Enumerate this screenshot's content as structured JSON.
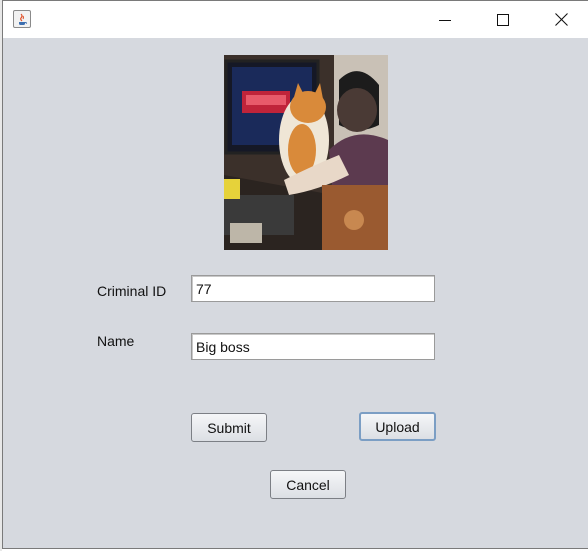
{
  "window": {
    "title": "",
    "app_icon": "java-icon",
    "controls": {
      "minimize": "minimize-icon",
      "maximize": "maximize-icon",
      "close": "close-icon"
    }
  },
  "photo": {
    "description_icon": "photo"
  },
  "form": {
    "criminal_id_label": "Criminal ID",
    "criminal_id_value": "77",
    "name_label": "Name",
    "name_value": "Big boss"
  },
  "buttons": {
    "submit": "Submit",
    "upload": "Upload",
    "cancel": "Cancel"
  },
  "colors": {
    "window_bg": "#d6d9df",
    "focus_border": "#7b9ec4"
  }
}
